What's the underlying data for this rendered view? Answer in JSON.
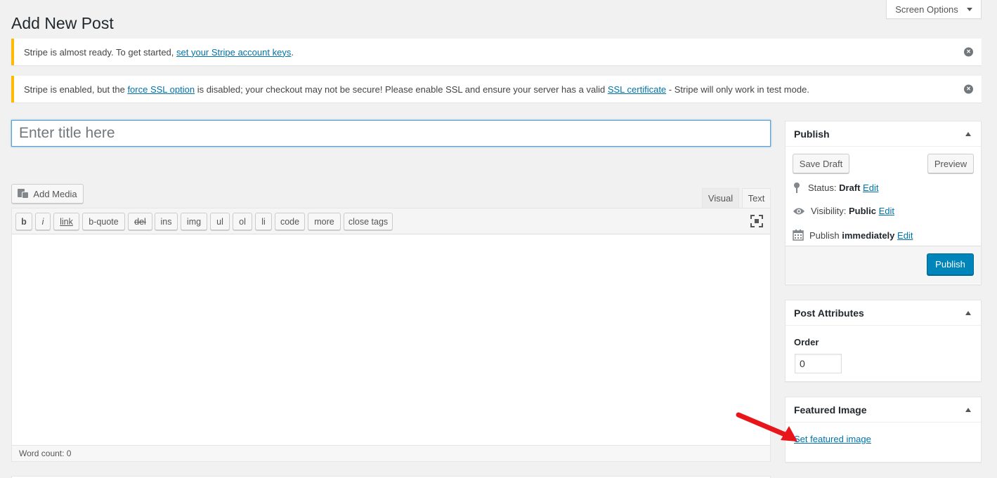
{
  "page": {
    "title": "Add New Post"
  },
  "screen_options": {
    "label": "Screen Options"
  },
  "notices": [
    {
      "before": "Stripe is almost ready. To get started, ",
      "link": "set your Stripe account keys",
      "after": "."
    },
    {
      "before": "Stripe is enabled, but the ",
      "link1": "force SSL option",
      "middle": " is disabled; your checkout may not be secure! Please enable SSL and ensure your server has a valid ",
      "link2": "SSL certificate",
      "after": " - Stripe will only work in test mode."
    }
  ],
  "title_field": {
    "placeholder": "Enter title here",
    "value": ""
  },
  "editor": {
    "add_media": "Add Media",
    "tabs": {
      "visual": "Visual",
      "text": "Text"
    },
    "quicktags": [
      "b",
      "i",
      "link",
      "b-quote",
      "del",
      "ins",
      "img",
      "ul",
      "ol",
      "li",
      "code",
      "more",
      "close tags"
    ],
    "word_count": "Word count: 0"
  },
  "publish_box": {
    "title": "Publish",
    "save_draft": "Save Draft",
    "preview": "Preview",
    "status_label": "Status: ",
    "status_value": "Draft",
    "visibility_label": "Visibility: ",
    "visibility_value": "Public",
    "publish_label": "Publish ",
    "publish_value": "immediately",
    "edit": "Edit",
    "publish_button": "Publish"
  },
  "post_attributes": {
    "title": "Post Attributes",
    "order_label": "Order",
    "order_value": "0"
  },
  "featured_image": {
    "title": "Featured Image",
    "link": "Set featured image"
  },
  "colors": {
    "accent": "#0073aa",
    "primary_button": "#0085ba",
    "notice_border": "#ffb900",
    "annotation_arrow": "#e8151b"
  },
  "icons": [
    "chevron-down-icon",
    "close-circle-icon",
    "media-icon",
    "fullscreen-icon",
    "pin-icon",
    "eye-icon",
    "calendar-icon",
    "arrow-annotation"
  ]
}
